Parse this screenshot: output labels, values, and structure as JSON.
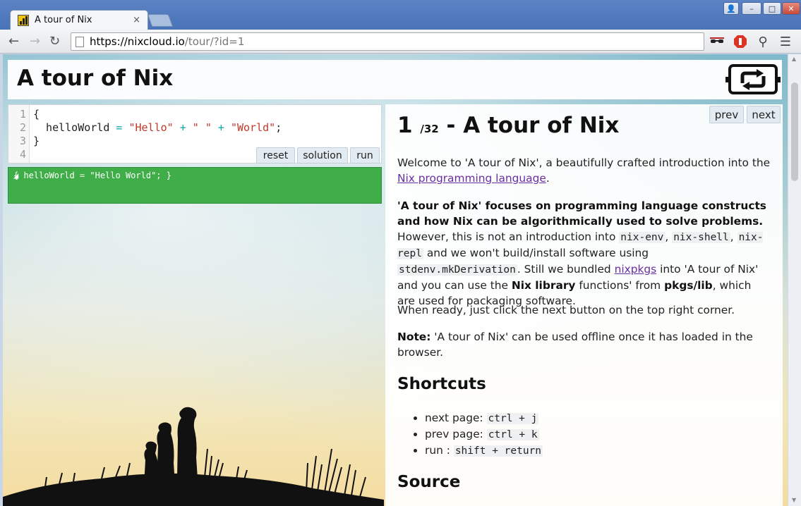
{
  "browser": {
    "tab_title": "A tour of Nix",
    "tab_close": "×",
    "url_host": "https://nixcloud.io",
    "url_path": "/tour/?id=1",
    "window_buttons": [
      "👤",
      "–",
      "□",
      "✕"
    ]
  },
  "header": {
    "title": "A tour of Nix"
  },
  "editor": {
    "line_numbers": [
      "1",
      "2",
      "3",
      "4"
    ],
    "line1": "{",
    "line2_key": "  helloWorld ",
    "line2_eq": "=",
    "line2_s1": "\"Hello\"",
    "line2_p1": "+",
    "line2_s2": "\" \"",
    "line2_p2": "+",
    "line2_s3": "\"World\"",
    "line2_end": ";",
    "line3": "}",
    "buttons": {
      "reset": "reset",
      "solution": "solution",
      "run": "run"
    }
  },
  "output": {
    "text": "{ helloWorld = \"Hello World\"; }"
  },
  "content": {
    "prev": "prev",
    "next": "next",
    "page_current": "1",
    "page_sep": "/",
    "page_total": "32",
    "title_suffix": "- A tour of Nix",
    "intro_text": "Welcome to 'A tour of Nix', a beautifully crafted introduction into the ",
    "intro_link": "Nix programming language",
    "intro_end": ".",
    "p2_bold": "'A tour of Nix' focuses on programming language constructs and how Nix can be algorithmically used to solve problems.",
    "p2_a": " However, this is not an introduction into ",
    "p2_code1": "nix-env",
    "p2_b": ", ",
    "p2_code2": "nix-shell",
    "p2_c": ", ",
    "p2_code3": "nix-repl",
    "p2_d": " and we won't build/install software using ",
    "p2_code4": "stdenv.mkDerivation",
    "p2_e": ". Still we bundled ",
    "p2_link": "nixpkgs",
    "p2_f": " into 'A tour of Nix' and you can use the ",
    "p2_bold2": "Nix library",
    "p2_g": " functions' from ",
    "p2_bold3": "pkgs/lib",
    "p2_h": ", which are used for packaging software.",
    "p3": "When ready, just click the next button on the top right corner.",
    "p4_bold": "Note:",
    "p4": " 'A tour of Nix' can be used offline once it has loaded in the browser.",
    "shortcuts_heading": "Shortcuts",
    "shortcuts": [
      {
        "label": "next page: ",
        "keys": "ctrl + j"
      },
      {
        "label": "prev page: ",
        "keys": "ctrl + k"
      },
      {
        "label": "run : ",
        "keys": "shift + return"
      }
    ],
    "source_heading": "Source"
  }
}
